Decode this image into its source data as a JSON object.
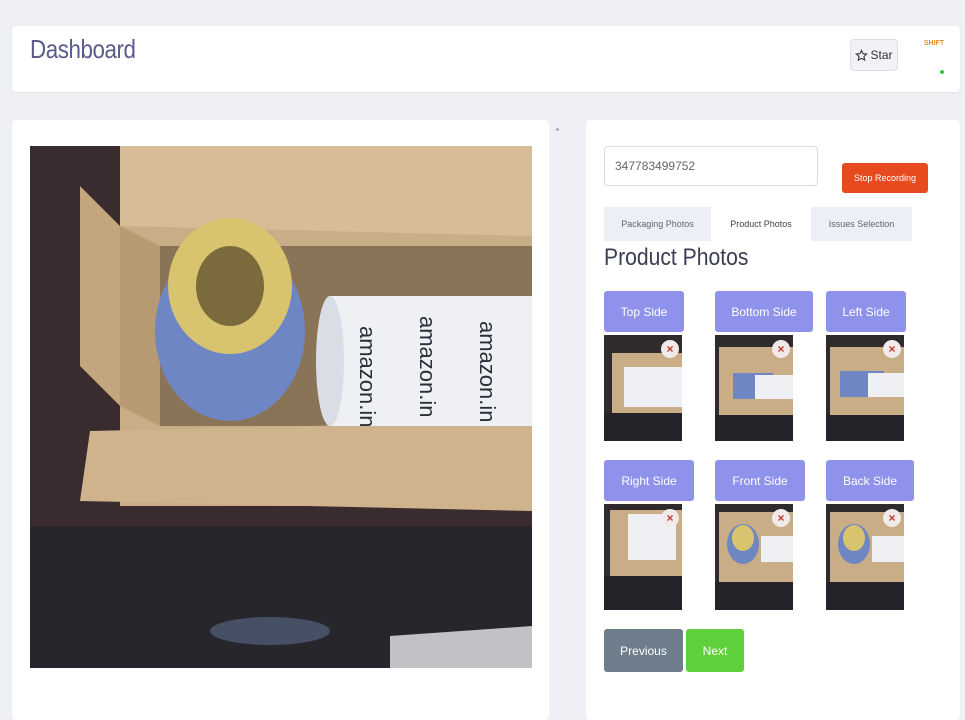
{
  "header": {
    "title": "Dashboard",
    "star_label": "Star",
    "status_text": "SHIFT"
  },
  "capture": {
    "awb_number": "347783499752",
    "stop_label": "Stop Recording"
  },
  "tabs": [
    {
      "label": "Packaging Photos"
    },
    {
      "label": "Product Photos"
    },
    {
      "label": "Issues Selection"
    }
  ],
  "section_title": "Product Photos",
  "photos": [
    {
      "label": "Top Side",
      "delete": "×"
    },
    {
      "label": "Bottom Side",
      "delete": "×"
    },
    {
      "label": "Left Side",
      "delete": "×"
    },
    {
      "label": "Right Side",
      "delete": "×"
    },
    {
      "label": "Front Side",
      "delete": "×"
    },
    {
      "label": "Back Side",
      "delete": "×"
    }
  ],
  "nav": {
    "previous_label": "Previous",
    "next_label": "Next"
  },
  "colors": {
    "accent": "#8e92ea",
    "stop": "#e84a20",
    "next": "#5ed03a",
    "previous": "#6f7e8c"
  }
}
